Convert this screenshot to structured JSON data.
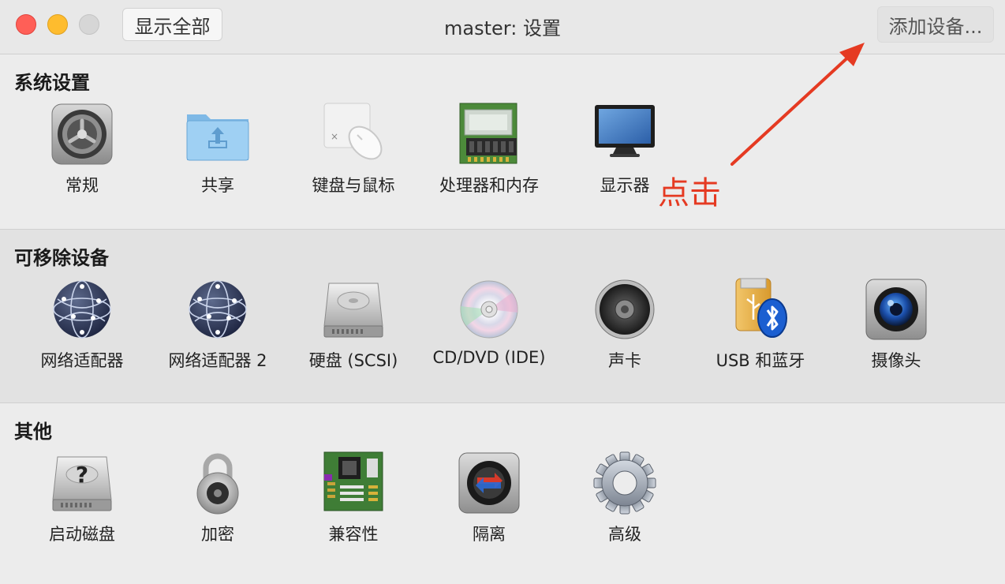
{
  "window": {
    "title": "master: 设置",
    "show_all": "显示全部",
    "add_device": "添加设备..."
  },
  "sections": [
    {
      "title": "系统设置",
      "items": [
        {
          "label": "常规",
          "icon": "general-gear-icon"
        },
        {
          "label": "共享",
          "icon": "shared-folder-icon"
        },
        {
          "label": "键盘与鼠标",
          "icon": "keyboard-mouse-icon"
        },
        {
          "label": "处理器和内存",
          "icon": "processor-memory-icon"
        },
        {
          "label": "显示器",
          "icon": "display-monitor-icon"
        }
      ]
    },
    {
      "title": "可移除设备",
      "items": [
        {
          "label": "网络适配器",
          "icon": "network-globe-icon"
        },
        {
          "label": "网络适配器 2",
          "icon": "network-globe-icon"
        },
        {
          "label": "硬盘 (SCSI)",
          "icon": "hard-disk-icon"
        },
        {
          "label": "CD/DVD (IDE)",
          "icon": "cd-dvd-icon"
        },
        {
          "label": "声卡",
          "icon": "speaker-icon"
        },
        {
          "label": "USB 和蓝牙",
          "icon": "usb-bluetooth-icon"
        },
        {
          "label": "摄像头",
          "icon": "camera-icon"
        }
      ]
    },
    {
      "title": "其他",
      "items": [
        {
          "label": "启动磁盘",
          "icon": "startup-disk-icon"
        },
        {
          "label": "加密",
          "icon": "padlock-icon"
        },
        {
          "label": "兼容性",
          "icon": "motherboard-icon"
        },
        {
          "label": "隔离",
          "icon": "isolation-icon"
        },
        {
          "label": "高级",
          "icon": "advanced-gear-icon"
        }
      ]
    }
  ],
  "annotation": {
    "text": "点击",
    "color": "#e53a22"
  },
  "colors": {
    "close": "#ff5f57",
    "minimize": "#febc2e",
    "zoom_disabled": "#d6d6d6"
  }
}
